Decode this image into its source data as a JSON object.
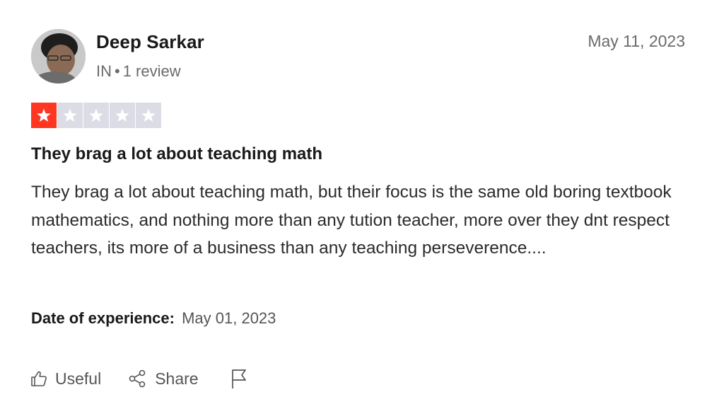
{
  "reviewer": {
    "name": "Deep Sarkar",
    "country": "IN",
    "separator": "•",
    "review_count": "1 review"
  },
  "review": {
    "date": "May 11, 2023",
    "rating": 1,
    "rating_max": 5,
    "title": "They brag a lot about teaching math",
    "body": "They brag a lot about teaching math, but their focus is the same old boring textbook mathematics, and nothing more than any tution teacher, more over they dnt respect teachers, its more of a business than any teaching perseverence....",
    "experience_label": "Date of experience:",
    "experience_date": "May 01, 2023"
  },
  "actions": {
    "useful_label": "Useful",
    "share_label": "Share"
  },
  "colors": {
    "star_filled": "#ff3722",
    "star_empty": "#dcdce6"
  },
  "icons": [
    "star-icon",
    "thumbs-up-icon",
    "share-icon",
    "flag-icon"
  ]
}
